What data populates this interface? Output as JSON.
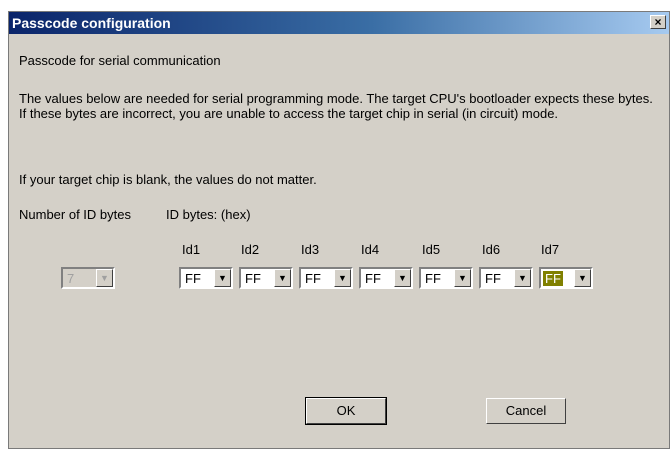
{
  "window": {
    "title": "Passcode configuration",
    "close_glyph": "×"
  },
  "heading": "Passcode for serial communication",
  "description": "The values below are needed for serial programming mode. The target CPU's bootloader expects these bytes. If these bytes are incorrect, you are unable to access the target chip in serial (in circuit) mode.",
  "blank_note": "If your target chip is blank, the values do not matter.",
  "num_bytes": {
    "label": "Number of ID bytes",
    "value": "7"
  },
  "id_bytes": {
    "label": "ID bytes: (hex)",
    "items": [
      {
        "label": "Id1",
        "value": "FF"
      },
      {
        "label": "Id2",
        "value": "FF"
      },
      {
        "label": "Id3",
        "value": "FF"
      },
      {
        "label": "Id4",
        "value": "FF"
      },
      {
        "label": "Id5",
        "value": "FF"
      },
      {
        "label": "Id6",
        "value": "FF"
      },
      {
        "label": "Id7",
        "value": "FF"
      }
    ]
  },
  "buttons": {
    "ok": "OK",
    "cancel": "Cancel"
  },
  "icons": {
    "dropdown": "▼",
    "close": "close-icon"
  }
}
